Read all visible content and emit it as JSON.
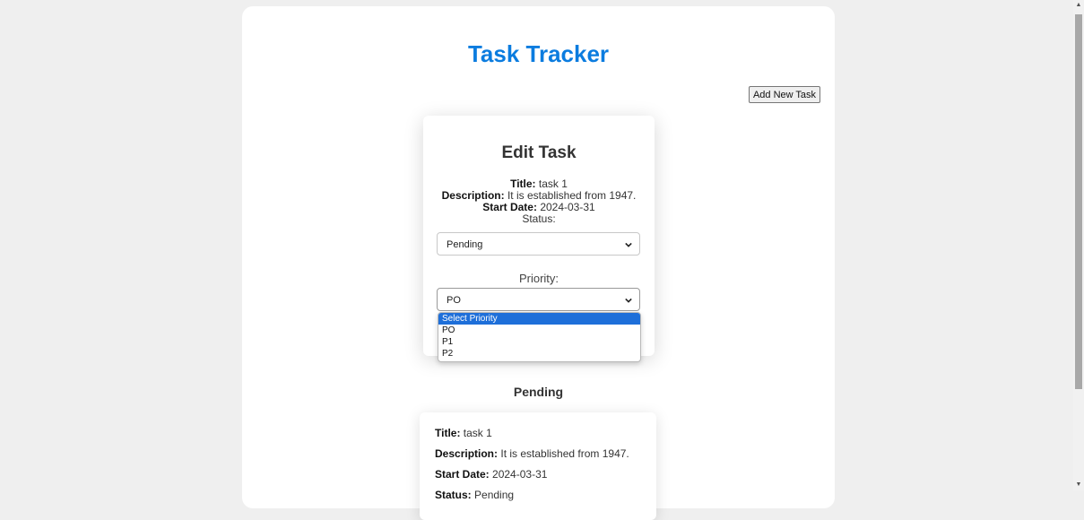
{
  "app": {
    "title": "Task Tracker",
    "add_button": "Add New Task"
  },
  "edit": {
    "heading": "Edit Task",
    "title_label": "Title:",
    "title_value": "task 1",
    "description_label": "Description:",
    "description_value": "It is established from 1947.",
    "start_label": "Start Date:",
    "start_value": "2024-03-31",
    "status_label": "Status:",
    "status_value": "Pending",
    "priority_label": "Priority:",
    "priority_value": "PO",
    "priority_options": [
      "Select Priority",
      "PO",
      "P1",
      "P2"
    ]
  },
  "list": {
    "section_title": "Pending",
    "card": {
      "title_label": "Title:",
      "title_value": "task 1",
      "description_label": "Description:",
      "description_value": "It is established from 1947.",
      "start_label": "Start Date:",
      "start_value": "2024-03-31",
      "status_label": "Status:",
      "status_value": "Pending"
    }
  },
  "colors": {
    "accent": "#0b7cdf",
    "selected_option": "#1e6fd9",
    "background": "#efefef"
  },
  "icons": {
    "select_arrow": "chevron-down-icon",
    "scroll_up": "scroll-up-arrow-icon",
    "scroll_down": "scroll-down-arrow-icon"
  }
}
